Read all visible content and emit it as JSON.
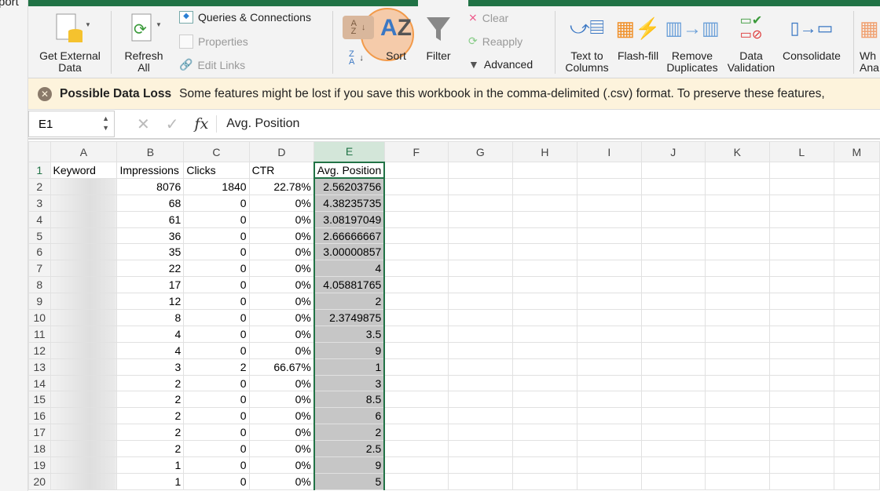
{
  "window": {
    "partial_title": "port"
  },
  "ribbon": {
    "get_external_data": "Get External\nData",
    "refresh_all": "Refresh\nAll",
    "queries": "Queries & Connections",
    "properties": "Properties",
    "edit_links": "Edit Links",
    "sort": "Sort",
    "filter": "Filter",
    "clear": "Clear",
    "reapply": "Reapply",
    "advanced": "Advanced",
    "text_to_columns": "Text to\nColumns",
    "flash_fill": "Flash-fill",
    "remove_duplicates": "Remove\nDuplicates",
    "data_validation": "Data\nValidation",
    "consolidate": "Consolidate",
    "what_if": "Wh\nAna"
  },
  "banner": {
    "title": "Possible Data Loss",
    "message": "Some features might be lost if you save this workbook in the comma-delimited (.csv) format. To preserve these features,"
  },
  "formula_bar": {
    "cell": "E1",
    "fx": "fx",
    "value": "Avg. Position"
  },
  "columns": [
    "A",
    "B",
    "C",
    "D",
    "E",
    "F",
    "G",
    "H",
    "I",
    "J",
    "K",
    "L",
    "M"
  ],
  "headers": [
    "Keyword",
    "Impressions",
    "Clicks",
    "CTR",
    "Avg. Position"
  ],
  "rows": [
    [
      "8076",
      "1840",
      "22.78%",
      "2.56203756"
    ],
    [
      "68",
      "0",
      "0%",
      "4.38235735"
    ],
    [
      "61",
      "0",
      "0%",
      "3.08197049"
    ],
    [
      "36",
      "0",
      "0%",
      "2.66666667"
    ],
    [
      "35",
      "0",
      "0%",
      "3.00000857"
    ],
    [
      "22",
      "0",
      "0%",
      "4"
    ],
    [
      "17",
      "0",
      "0%",
      "4.05881765"
    ],
    [
      "12",
      "0",
      "0%",
      "2"
    ],
    [
      "8",
      "0",
      "0%",
      "2.3749875"
    ],
    [
      "4",
      "0",
      "0%",
      "3.5"
    ],
    [
      "4",
      "0",
      "0%",
      "9"
    ],
    [
      "3",
      "2",
      "66.67%",
      "1"
    ],
    [
      "2",
      "0",
      "0%",
      "3"
    ],
    [
      "2",
      "0",
      "0%",
      "8.5"
    ],
    [
      "2",
      "0",
      "0%",
      "6"
    ],
    [
      "2",
      "0",
      "0%",
      "2"
    ],
    [
      "2",
      "0",
      "0%",
      "2.5"
    ],
    [
      "1",
      "0",
      "0%",
      "9"
    ],
    [
      "1",
      "0",
      "0%",
      "5"
    ]
  ]
}
